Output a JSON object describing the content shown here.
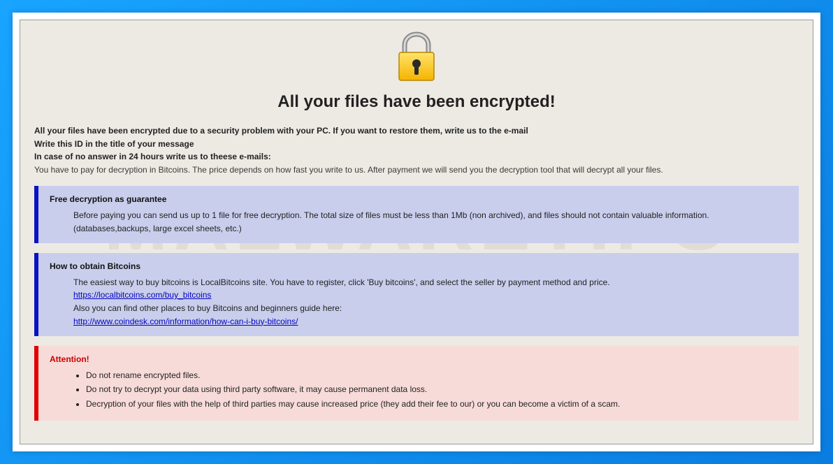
{
  "watermark": "MALWARETIPS",
  "title": "All your files have been encrypted!",
  "intro": {
    "l1": "All your files have been encrypted due to a security problem with your PC. If you want to restore them, write us to the e-mail",
    "l2": "Write this ID in the title of your message",
    "l3": "In case of no answer in 24 hours write us to theese e-mails:",
    "l4": "You have to pay for decryption in Bitcoins. The price depends on how fast you write to us. After payment we will send you the decryption tool that will decrypt all your files."
  },
  "box1": {
    "heading": "Free decryption as guarantee",
    "body": "Before paying you can send us up to 1 file for free decryption. The total size of files must be less than 1Mb (non archived), and files should not contain valuable information. (databases,backups, large excel sheets, etc.)"
  },
  "box2": {
    "heading": "How to obtain Bitcoins",
    "line_a": "The easiest way to buy bitcoins is LocalBitcoins site. You have to register, click 'Buy bitcoins', and select the seller by payment method and price.",
    "link_a": "https://localbitcoins.com/buy_bitcoins",
    "line_b": "Also you can find other places to buy Bitcoins and beginners guide here:",
    "link_b": "http://www.coindesk.com/information/how-can-i-buy-bitcoins/"
  },
  "box3": {
    "heading": "Attention!",
    "items": [
      "Do not rename encrypted files.",
      "Do not try to decrypt your data using third party software, it may cause permanent data loss.",
      "Decryption of your files with the help of third parties may cause increased price (they add their fee to our) or you can become a victim of a scam."
    ]
  }
}
